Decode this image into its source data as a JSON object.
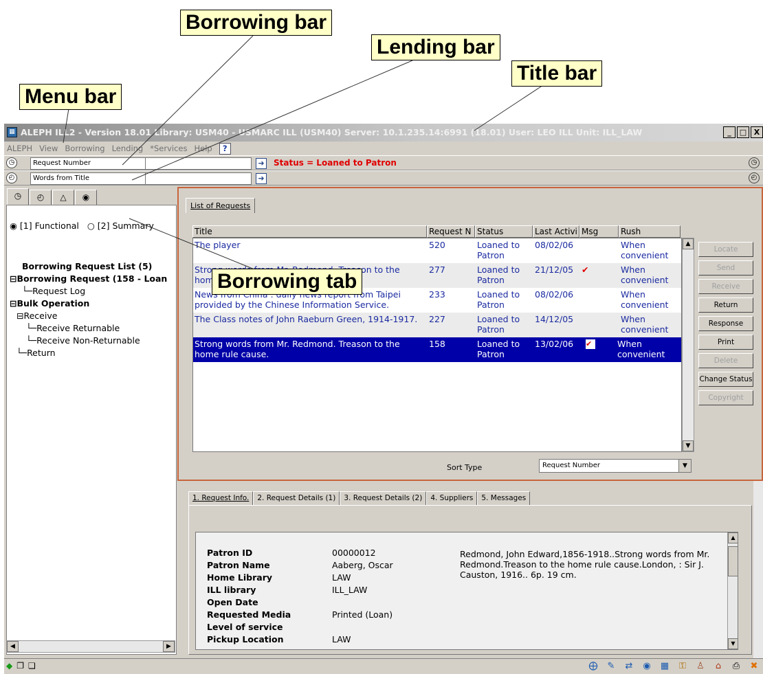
{
  "callouts": {
    "borrowing_bar": "Borrowing bar",
    "lending_bar": "Lending bar",
    "title_bar": "Title bar",
    "menu_bar": "Menu bar",
    "borrowing_tab": "Borrowing tab"
  },
  "window": {
    "title": "ALEPH ILL2 - Version 18.01  Library:  USM40 - USMARC ILL (USM40)  Server:  10.1.235.14:6991 (18.01)  User:  LEO  ILL Unit: ILL_LAW",
    "controls": [
      "_",
      "□",
      "X"
    ]
  },
  "menu": [
    "ALEPH",
    "View",
    "Borrowing",
    "Lending",
    "*Services",
    "Help"
  ],
  "borrowing_bar": {
    "search_type": "Request Number",
    "status": "Status = Loaned to Patron"
  },
  "lending_bar": {
    "search_type": "Words from Title"
  },
  "left_panel": {
    "radio_functional": "[1] Functional",
    "radio_summary": "[2] Summary",
    "tree": [
      "Borrowing Request List (5)",
      "Borrowing Request (158 - Loan",
      "Request Log",
      "Bulk Operation",
      "Receive",
      "Receive Returnable",
      "Receive Non-Returnable",
      "Return"
    ]
  },
  "requests": {
    "tab_label": "List of Requests",
    "columns": [
      "Title",
      "Request N",
      "Status",
      "Last Activi",
      "Msg",
      "Rush"
    ],
    "rows": [
      {
        "title": "The player",
        "number": "520",
        "status": "Loaned to Patron",
        "last_activity": "08/02/06",
        "msg": "",
        "rush": "When convenient"
      },
      {
        "title": "Strong words from Mr. Redmond. Treason to the home rule cause.",
        "number": "277",
        "status": "Loaned to Patron",
        "last_activity": "21/12/05",
        "msg": "✔",
        "rush": "When convenient"
      },
      {
        "title": "News from China : daily news report from Taipei provided by the Chinese Information Service.",
        "number": "233",
        "status": "Loaned to Patron",
        "last_activity": "08/02/06",
        "msg": "",
        "rush": "When convenient"
      },
      {
        "title": "The Class notes of John Raeburn Green, 1914-1917.",
        "number": "227",
        "status": "Loaned to Patron",
        "last_activity": "14/12/05",
        "msg": "",
        "rush": "When convenient"
      },
      {
        "title": "Strong words from Mr. Redmond. Treason to the home rule cause.",
        "number": "158",
        "status": "Loaned to Patron",
        "last_activity": "13/02/06",
        "msg": "✔",
        "rush": "When convenient"
      }
    ],
    "actions": [
      "Locate",
      "Send",
      "Receive",
      "Return",
      "Response",
      "Print",
      "Delete",
      "Change Status",
      "Copyright"
    ],
    "sort_label": "Sort Type",
    "sort_value": "Request Number"
  },
  "details": {
    "tabs": [
      "1. Request Info.",
      "2. Request Details (1)",
      "3. Request Details (2)",
      "4. Suppliers",
      "5. Messages"
    ],
    "fields": [
      {
        "label": "Patron ID",
        "value": "00000012"
      },
      {
        "label": "Patron Name",
        "value": "Aaberg, Oscar"
      },
      {
        "label": "Home Library",
        "value": "LAW"
      },
      {
        "label": "ILL library",
        "value": "ILL_LAW"
      },
      {
        "label": "Open Date",
        "value": ""
      },
      {
        "label": "Requested Media",
        "value": "Printed (Loan)"
      },
      {
        "label": "Level of service",
        "value": ""
      },
      {
        "label": "Pickup Location",
        "value": "LAW"
      }
    ],
    "note": "Redmond, John Edward,1856-1918..Strong words from Mr. Redmond.Treason to the home rule cause.London, : Sir J. Causton, 1916.. 6p. 19 cm."
  }
}
